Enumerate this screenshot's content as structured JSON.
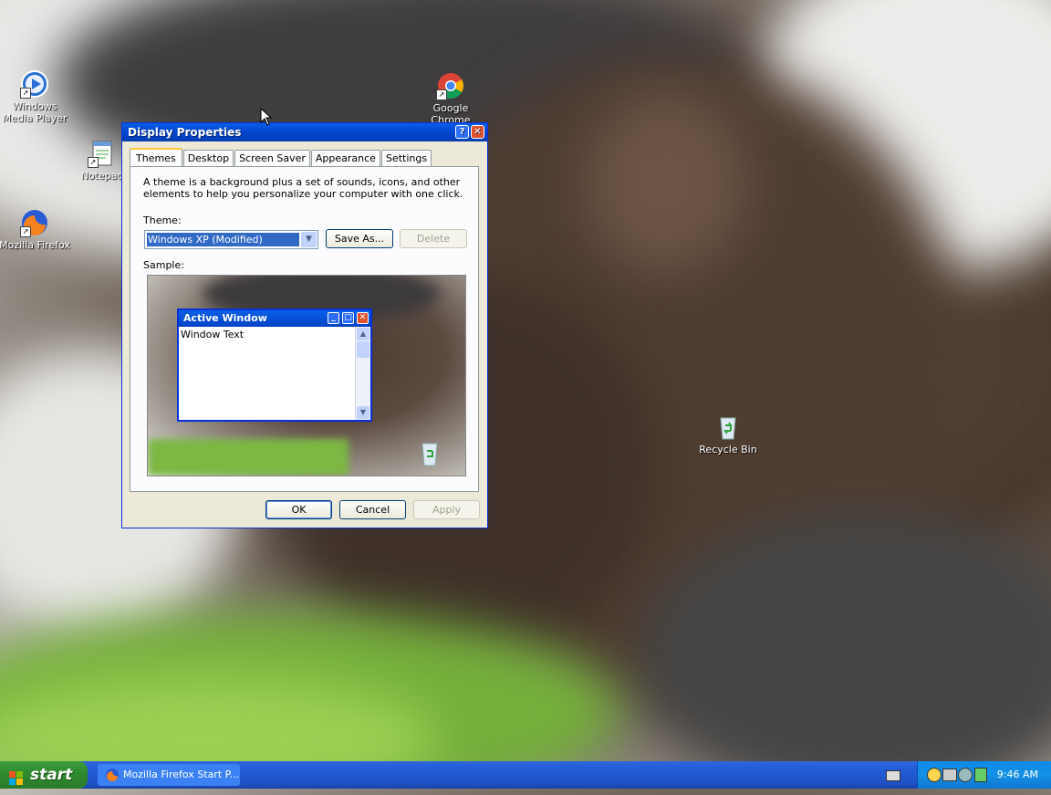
{
  "desktop": {
    "icons": [
      {
        "label": "Windows Media Player",
        "icon": "media-player-icon"
      },
      {
        "label": "Notepad",
        "icon": "notepad-icon"
      },
      {
        "label": "Mozilla Firefox",
        "icon": "firefox-icon"
      },
      {
        "label": "Google Chrome",
        "icon": "chrome-icon"
      },
      {
        "label": "Recycle Bin",
        "icon": "recycle-bin-icon"
      }
    ]
  },
  "dialog": {
    "title": "Display Properties",
    "tabs": [
      {
        "label": "Themes",
        "active": true
      },
      {
        "label": "Desktop"
      },
      {
        "label": "Screen Saver"
      },
      {
        "label": "Appearance"
      },
      {
        "label": "Settings"
      }
    ],
    "description": "A theme is a background plus a set of sounds, icons, and other elements to help you personalize your computer with one click.",
    "theme_label": "Theme:",
    "theme_value": "Windows XP (Modified)",
    "save_as_label": "Save As...",
    "delete_label": "Delete",
    "sample_label": "Sample:",
    "sample_window": {
      "title": "Active Window",
      "text": "Window Text"
    },
    "ok_label": "OK",
    "cancel_label": "Cancel",
    "apply_label": "Apply"
  },
  "taskbar": {
    "start_label": "start",
    "tasks": [
      {
        "label": "Mozilla Firefox Start P...",
        "icon": "firefox-icon"
      }
    ],
    "clock": "9:46 AM"
  },
  "colors": {
    "title_blue": "#0449d3",
    "taskbar_blue": "#245edb",
    "start_green": "#2f8b2f",
    "dialog_bg": "#ece9d8"
  }
}
